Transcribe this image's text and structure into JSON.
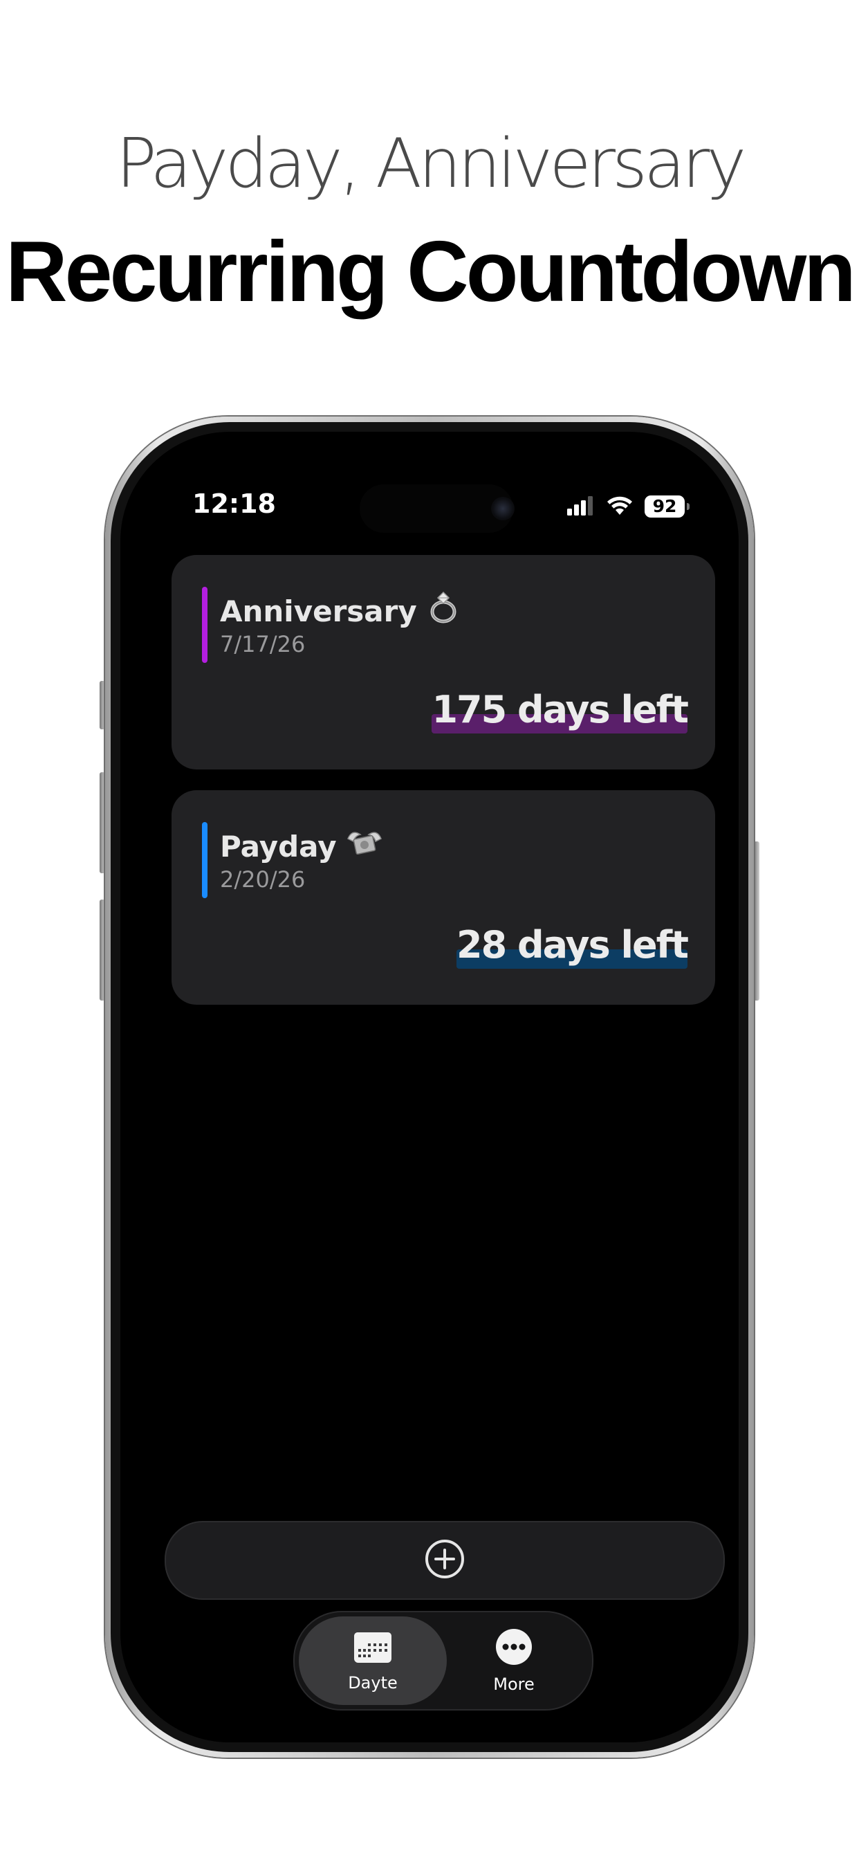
{
  "promo": {
    "subtitle": "Payday, Anniversary",
    "title": "Recurring Countdown"
  },
  "status_bar": {
    "time": "12:18",
    "battery": "92",
    "icons": [
      "cellular-signal-icon",
      "wifi-icon",
      "battery-icon"
    ]
  },
  "countdowns": [
    {
      "title": "Anniversary",
      "emoji": "💍",
      "date": "7/17/26",
      "days_left": "175 days left",
      "accent_color": "#b41fe0",
      "highlight_color": "#5a1f6a"
    },
    {
      "title": "Payday",
      "emoji": "💸",
      "date": "2/20/26",
      "days_left": "28 days left",
      "accent_color": "#1a8cff",
      "highlight_color": "#0c3d63"
    }
  ],
  "add_button": {
    "icon": "plus-circle-icon"
  },
  "tab_bar": {
    "tabs": [
      {
        "label": "Dayte",
        "icon": "calendar-icon",
        "active": true
      },
      {
        "label": "More",
        "icon": "ellipsis-circle-icon",
        "active": false
      }
    ]
  }
}
